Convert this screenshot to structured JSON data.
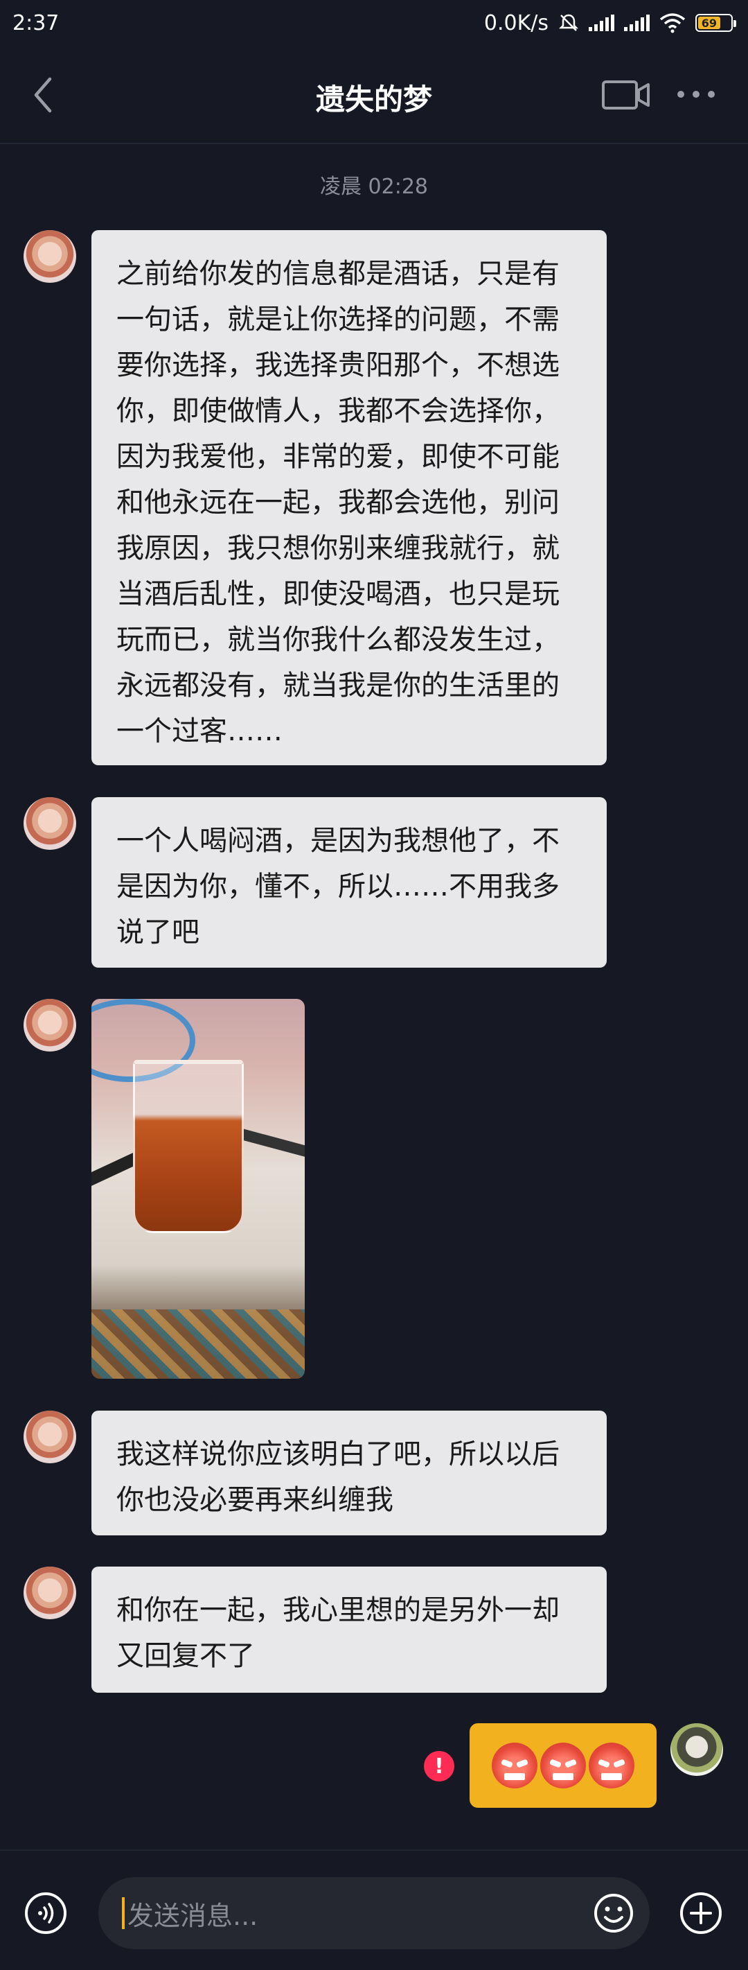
{
  "status_bar": {
    "time": "2:37",
    "network_speed": "0.0K/s",
    "battery": "69",
    "battery_level_percent": 69,
    "icons": [
      "mute-bell-icon",
      "signal-icon",
      "signal-icon",
      "wifi-icon",
      "battery-icon"
    ]
  },
  "header": {
    "title": "遗失的梦",
    "icons": [
      "back-icon",
      "video-call-icon",
      "more-icon"
    ]
  },
  "conversation": {
    "timestamp": "凌晨 02:28",
    "messages": [
      {
        "sender": "other",
        "type": "text",
        "text": "之前给你发的信息都是酒话，只是有一句话，就是让你选择的问题，不需要你选择，我选择贵阳那个，不想选你，即使做情人，我都不会选择你，因为我爱他，非常的爱，即使不可能和他永远在一起，我都会选他，别问我原因，我只想你别来缠我就行，就当酒后乱性，即使没喝酒，也只是玩玩而已，就当你我什么都没发生过，永远都没有，就当我是你的生活里的一个过客……"
      },
      {
        "sender": "other",
        "type": "text",
        "text": "一个人喝闷酒，是因为我想他了，不是因为你，懂不，所以……不用我多说了吧"
      },
      {
        "sender": "other",
        "type": "image"
      },
      {
        "sender": "other",
        "type": "text",
        "text": "我这样说你应该明白了吧，所以以后你也没必要再来纠缠我"
      },
      {
        "sender": "other",
        "type": "text",
        "text": "和你在一起，我心里想的是另外一却又回复不了"
      },
      {
        "sender": "me",
        "type": "emoji",
        "emoji": [
          "angry-emoji",
          "angry-emoji",
          "angry-emoji"
        ],
        "status": "failed"
      }
    ]
  },
  "input_bar": {
    "placeholder": "发送消息...",
    "icons": [
      "voice-icon",
      "emoji-icon",
      "add-icon"
    ]
  },
  "colors": {
    "background": "#161823",
    "bubble_received": "#e8e8ea",
    "bubble_sent": "#f2b21f",
    "error": "#fe2c55",
    "accent_caret": "#f2b21f"
  }
}
